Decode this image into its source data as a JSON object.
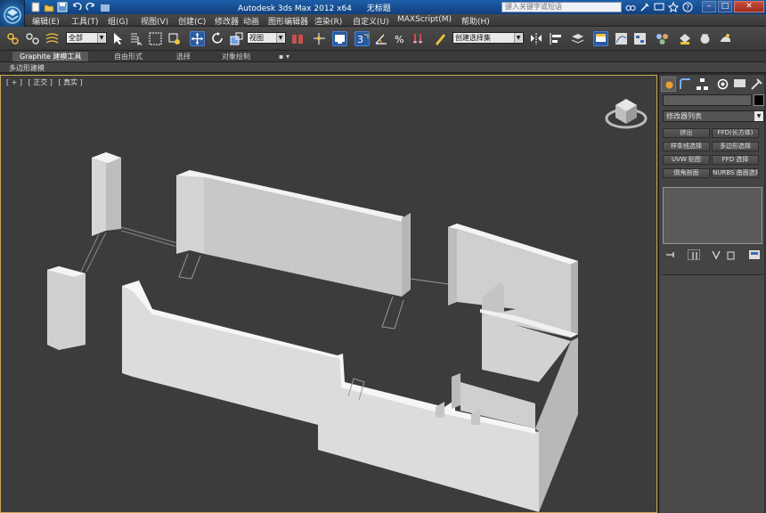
{
  "titlebar": {
    "app_title": "Autodesk 3ds Max  2012 x64",
    "doc_title": "无标题",
    "search_placeholder": "键入关键字或短语",
    "colors": {
      "bar": "#1d5fa8",
      "close": "#c9503e"
    }
  },
  "menu": {
    "items": [
      "编辑(E)",
      "工具(T)",
      "组(G)",
      "视图(V)",
      "创建(C)",
      "修改器",
      "动画",
      "图形编辑器",
      "渲染(R)",
      "自定义(U)",
      "MAXScript(M)",
      "帮助(H)"
    ]
  },
  "toolbar": {
    "selection_filter": "全部",
    "reference_coord": "视图",
    "named_selection": "创建选择集"
  },
  "ribbon": {
    "tabs": [
      "Graphite 建模工具",
      "自由形式",
      "选择",
      "对象绘制"
    ],
    "active_tab": "Graphite 建模工具",
    "sub_label": "多边形建模"
  },
  "viewport": {
    "labels": [
      "[ + ]",
      "[ 正交 ]",
      "[ 真实 ]"
    ],
    "border_color": "#caa850",
    "background": "#3c3c3c"
  },
  "command_panel": {
    "modifier_list": "修改器列表",
    "buttons": [
      [
        "挤出",
        "FFD(长方体)"
      ],
      [
        "样条线选择",
        "多边形选择"
      ],
      [
        "UVW 贴图",
        "FFD 选择"
      ],
      [
        "倒角剖面",
        "NURBS 曲面选择"
      ]
    ]
  }
}
